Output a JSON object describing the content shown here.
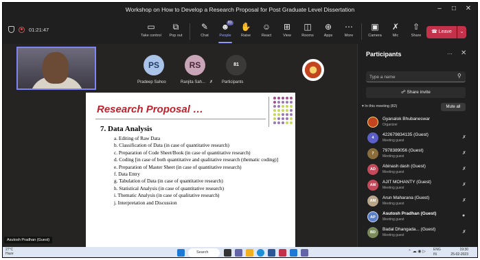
{
  "window": {
    "title": "Workshop on How to Develop a Research Proposal for Post Graduate Level Dissertation",
    "minimize_icon": "minimize-icon",
    "maximize_icon": "maximize-icon",
    "close_icon": "close-icon"
  },
  "toolbar": {
    "timer": "01:21:47",
    "buttons": [
      {
        "label": "Take control",
        "icon": "take-control-icon"
      },
      {
        "label": "Pop out",
        "icon": "pop-out-icon"
      },
      {
        "label": "Chat",
        "icon": "chat-icon"
      },
      {
        "label": "People",
        "icon": "people-icon",
        "badge": "81"
      },
      {
        "label": "Raise",
        "icon": "raise-hand-icon"
      },
      {
        "label": "React",
        "icon": "react-icon"
      },
      {
        "label": "View",
        "icon": "view-icon"
      },
      {
        "label": "Rooms",
        "icon": "rooms-icon"
      },
      {
        "label": "Apps",
        "icon": "apps-icon"
      },
      {
        "label": "More",
        "icon": "more-icon"
      },
      {
        "label": "Camera",
        "icon": "camera-icon"
      },
      {
        "label": "Mic",
        "icon": "mic-icon"
      },
      {
        "label": "Share",
        "icon": "share-icon"
      }
    ],
    "leave_label": "Leave"
  },
  "stage": {
    "tiles": [
      {
        "initials": "PS",
        "name": "Pradeep Sahoo",
        "color": "#a9c4e8"
      },
      {
        "initials": "RS",
        "name": "Ranjita Sah...",
        "color": "#c8a6b8"
      },
      {
        "initials": "81",
        "name": "Participants",
        "color": "#3b3a39"
      }
    ],
    "self_view_name": "Asutosh Pradhan (Guest)"
  },
  "slide": {
    "title": "Research Proposal …",
    "heading": "7.  Data Analysis",
    "items": [
      "a. Editing of Raw Data",
      "b. Classification of Data (in case of quantitative research)",
      "c. Preparation of Code Sheet/Book (in case of quantitative research)",
      "d. Coding [in case of both quantitative and qualitative research (thematic coding)]",
      "e. Preparation of Master Sheet (in case of quantitative research)",
      "f. Data Entry",
      "g. Tabulation of Data (in case of quantitative research)",
      "h. Statistical Analysis (in case of quantitative research)",
      "i. Thematic Analysis (in case of qualitative research)",
      "j. Interpretation and Discussion"
    ]
  },
  "panel": {
    "title": "Participants",
    "search_placeholder": "Type a name",
    "share_invite": "Share invite",
    "section_label": "In this meeting (82)",
    "mute_all": "Mute all",
    "participants": [
      {
        "name": "Gyanalok Bhubaneswar",
        "role": "Organizer",
        "initials": "",
        "color": "#c2451f"
      },
      {
        "name": "422679834135 (Guest)",
        "role": "Meeting guest",
        "initials": "4",
        "color": "#5b5fc7"
      },
      {
        "name": "7978389056 (Guest)",
        "role": "Meeting guest",
        "initials": "7",
        "color": "#8a6d3b"
      },
      {
        "name": "Abinash dash (Guest)",
        "role": "Meeting guest",
        "initials": "AD",
        "color": "#c44a5b"
      },
      {
        "name": "AJIT MOHANTY (Guest)",
        "role": "Meeting guest",
        "initials": "AM",
        "color": "#c44a5b"
      },
      {
        "name": "Arun Maharana (Guest)",
        "role": "Meeting guest",
        "initials": "AM",
        "color": "#b8a58a"
      },
      {
        "name": "Asutosh Pradhan (Guest)",
        "role": "Meeting guest",
        "initials": "AP",
        "color": "#5b7fc7"
      },
      {
        "name": "Badal Dhangada... (Guest)",
        "role": "Meeting guest",
        "initials": "BD",
        "color": "#7b8a5b"
      }
    ]
  },
  "taskbar": {
    "temperature": "27°C",
    "weather": "Haze",
    "search_label": "Search",
    "lang": "ENG",
    "region": "IN",
    "time": "19:30",
    "date": "25-02-2023"
  },
  "colors": {
    "accent": "#6264a7",
    "leave": "#c4314b",
    "slide_title": "#c0202a"
  }
}
